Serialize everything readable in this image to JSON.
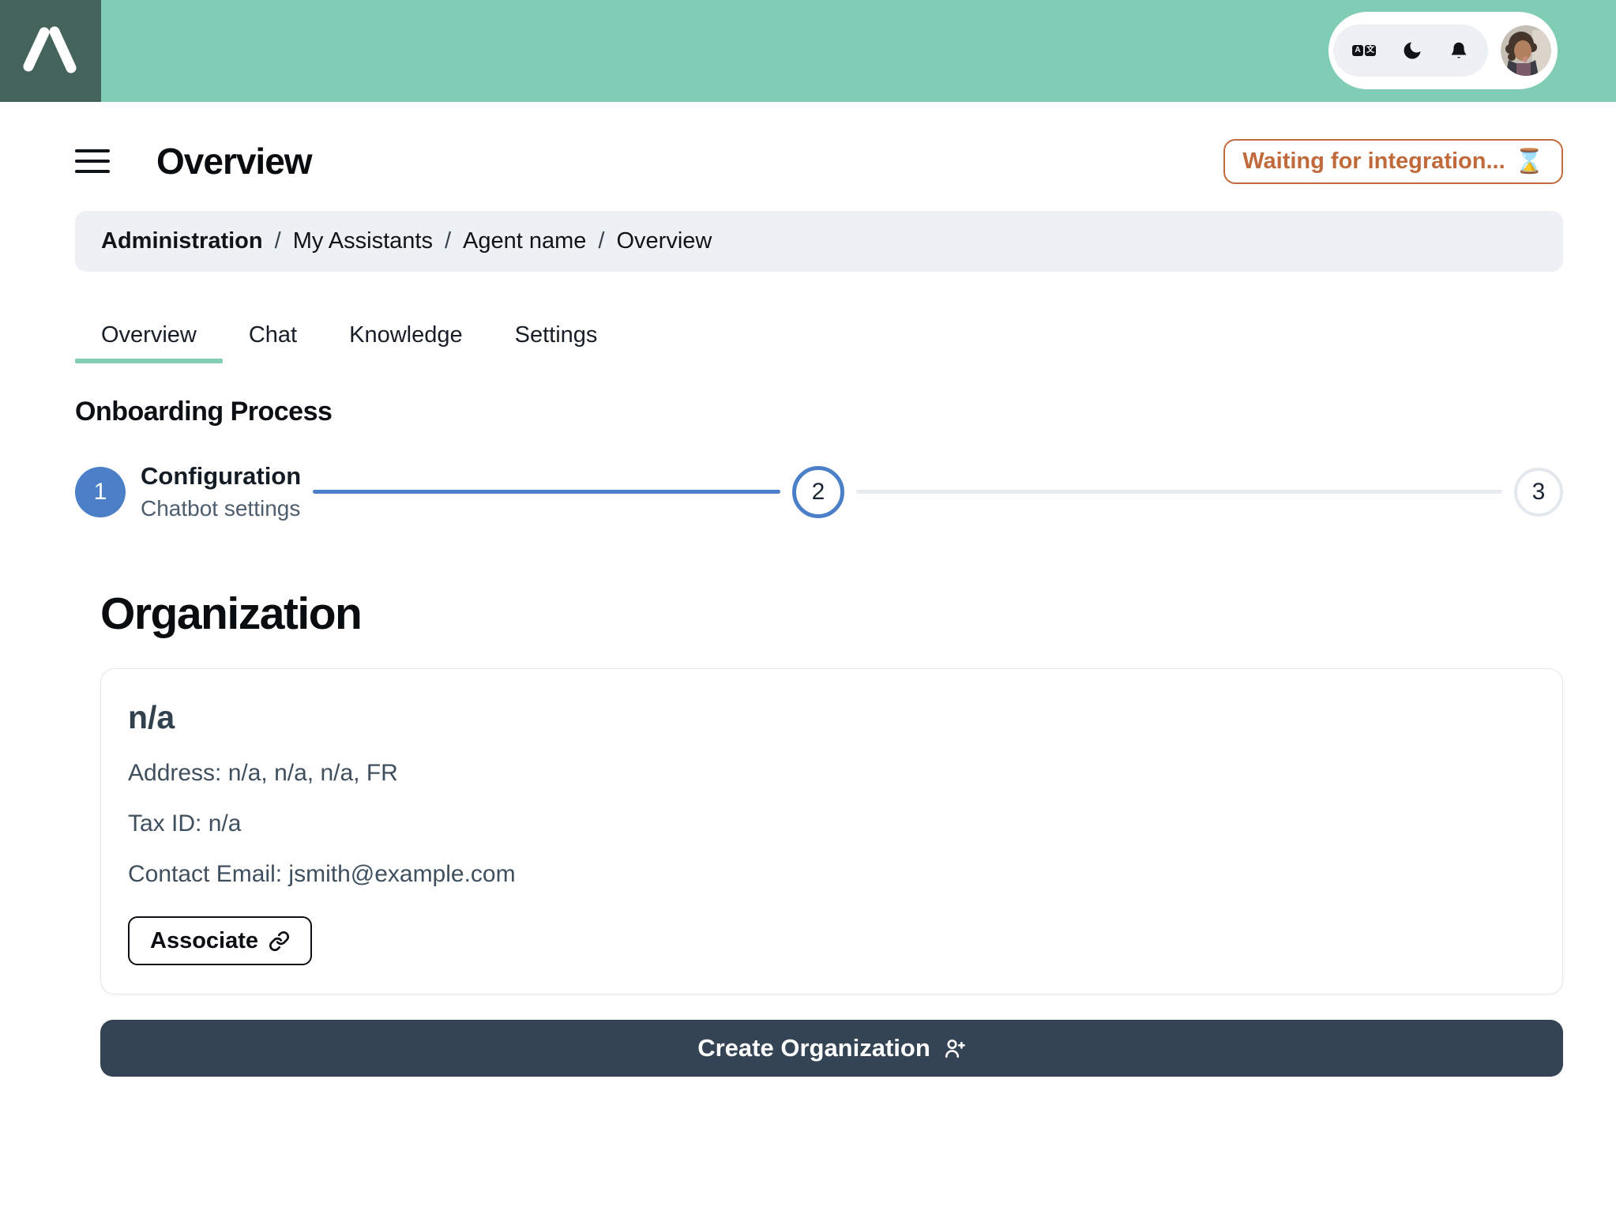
{
  "theme": {
    "header_green": "#80CCB4",
    "logo_bg": "#44645B",
    "accent_blue": "#4B80C8",
    "badge_orange": "#C0693A",
    "dark_button": "#344454",
    "pill_bg": "#EDF1F5"
  },
  "topbar": {
    "translate_icon_letters": {
      "left": "A",
      "right": "文"
    }
  },
  "page": {
    "title": "Overview",
    "status_badge": {
      "label": "Waiting for integration...",
      "icon": "⌛"
    }
  },
  "breadcrumb": {
    "separator": "/",
    "items": [
      {
        "label": "Administration"
      },
      {
        "label": "My Assistants"
      },
      {
        "label": "Agent name"
      },
      {
        "label": "Overview"
      }
    ]
  },
  "tabs": [
    {
      "label": "Overview",
      "active": true
    },
    {
      "label": "Chat",
      "active": false
    },
    {
      "label": "Knowledge",
      "active": false
    },
    {
      "label": "Settings",
      "active": false
    }
  ],
  "onboarding": {
    "title": "Onboarding Process",
    "steps": [
      {
        "number": "1",
        "label": "Configuration",
        "sublabel": "Chatbot settings",
        "state": "completed-active"
      },
      {
        "number": "2",
        "state": "current"
      },
      {
        "number": "3",
        "state": "upcoming"
      }
    ]
  },
  "organization": {
    "title": "Organization",
    "card": {
      "name": "n/a",
      "address_line": "Address: n/a, n/a, n/a, FR",
      "tax_line": "Tax ID: n/a",
      "email_line": "Contact Email: jsmith@example.com",
      "associate_label": "Associate"
    },
    "create_button_label": "Create Organization"
  }
}
